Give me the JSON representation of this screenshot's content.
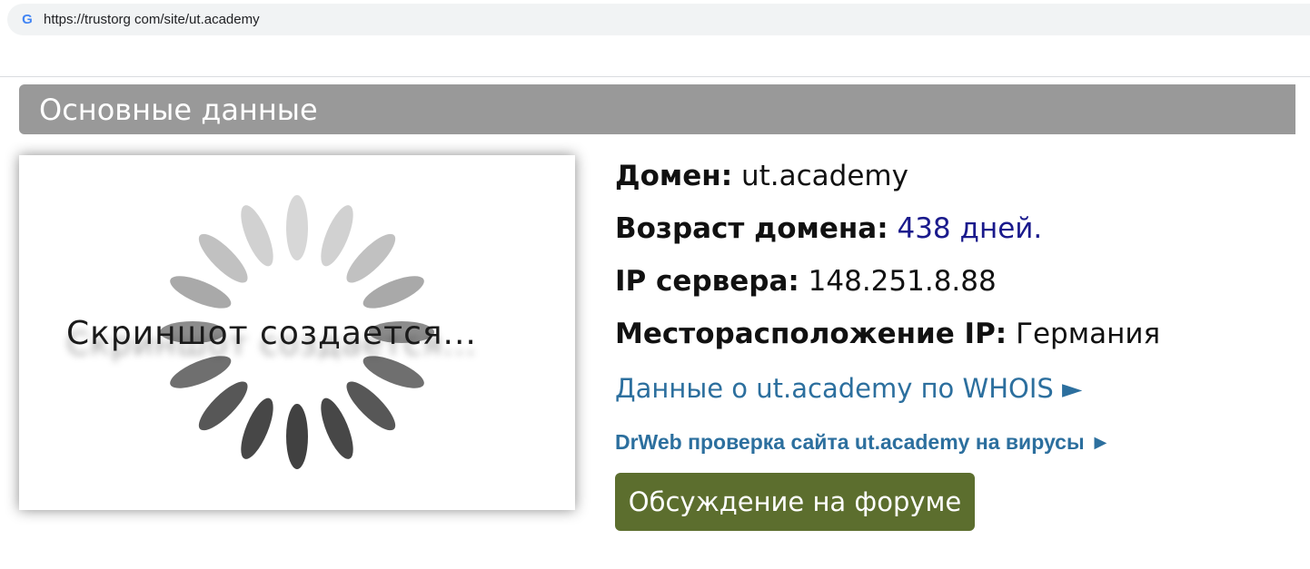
{
  "browser": {
    "favicon": "G",
    "url": "https://trustorg com/site/ut.academy"
  },
  "section": {
    "title": "Основные данные"
  },
  "thumbnail": {
    "caption": "Скриншот создается..."
  },
  "info": {
    "domain_label": "Домен:",
    "domain_value": "ut.academy",
    "age_label": "Возраст домена:",
    "age_value": "438 дней.",
    "ip_label": "IP сервера:",
    "ip_value": "148.251.8.88",
    "location_label": "Месторасположение IP:",
    "location_value": "Германия",
    "whois_link": "Данные о ut.academy по WHOIS ►",
    "drweb_link": "DrWeb проверка сайта ut.academy на вирусы ►",
    "forum_button": "Обсуждение на форуме"
  },
  "colors": {
    "header_bg": "#999999",
    "age_value": "#1a1a8c",
    "link": "#2c6f9e",
    "forum_button_bg": "#5c6e2e"
  }
}
